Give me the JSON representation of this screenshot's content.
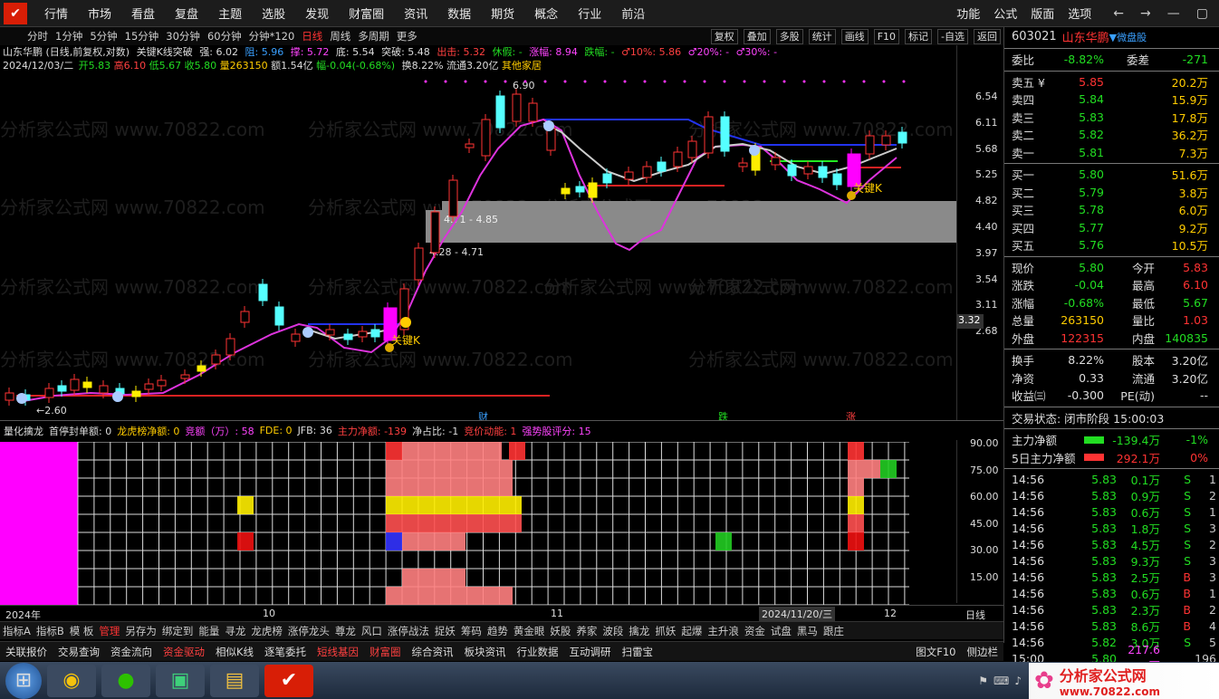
{
  "topmenu": [
    "行情",
    "市场",
    "看盘",
    "复盘",
    "主题",
    "选股",
    "发现",
    "财富圈",
    "资讯",
    "数据",
    "期货",
    "概念",
    "行业",
    "前沿"
  ],
  "topright": [
    "功能",
    "公式",
    "版面",
    "选项"
  ],
  "periods": [
    "分时",
    "1分钟",
    "5分钟",
    "15分钟",
    "30分钟",
    "60分钟",
    "分钟*120",
    "日线",
    "周线",
    "多周期",
    "更多"
  ],
  "tools": [
    "复权",
    "叠加",
    "多股",
    "统计",
    "画线",
    "F10",
    "标记",
    "-自选",
    "返回"
  ],
  "info": {
    "line1_a": "山东华鹏 (日线,前复权,对数)",
    "line1_b": "关键K线突破",
    "qiang": "强: 6.02",
    "zu": "阻: 5.96",
    "cheng": "撑: 5.72",
    "di": "底: 5.54",
    "tupo": "突破: 5.48",
    "shouyi": "出击: 5.32",
    "xiupan": "休假: -",
    "zhangfu": "涨幅: 8.94",
    "diefu": "跌幅: -",
    "p10": "♂10%: 5.86",
    "p20": "♂20%: -",
    "p30": "♂30%: -",
    "date": "2024/12/03/二",
    "open": "开5.83",
    "high": "高6.10",
    "low": "低5.67",
    "close": "收5.80",
    "vol": "量263150",
    "amt": "额1.54亿",
    "chg": "幅-0.04(-0.68%)",
    "turn": "换8.22%",
    "flow": "流通3.20亿",
    "other": "其他家居"
  },
  "annotations": {
    "high": "6.90",
    "low": "←2.60",
    "zone1": "4.71 - 4.85",
    "zone2": "4.28 - 4.71",
    "key1": "关键K",
    "key2": "关键K",
    "ev1": "财",
    "ev2": "跌",
    "ev3": "涨",
    "cur": "3.32"
  },
  "price_axis": [
    "6.54",
    "6.11",
    "5.68",
    "5.25",
    "4.82",
    "4.40",
    "3.97",
    "3.54",
    "3.11",
    "2.68"
  ],
  "ind": {
    "name": "量化擒龙",
    "a": "首停封单额: 0",
    "b": "龙虎榜净额: 0",
    "c": "竞额（万）: 58",
    "d": "FDE: 0",
    "e": "JFB: 36",
    "f": "主力净额: -139",
    "g": "净占比: -1",
    "h": "竞价动能: 1",
    "i": "强势股评分: 15"
  },
  "grid_axis": [
    "90.00",
    "75.00",
    "60.00",
    "45.00",
    "30.00",
    "15.00"
  ],
  "dates": {
    "y": "2024年",
    "m10": "10",
    "m11": "11",
    "d": "2024/11/20/三",
    "m12": "12",
    "p": "日线"
  },
  "tabs1": [
    "指标A",
    "指标B",
    "模 板",
    "管理",
    "另存为",
    "绑定到",
    "能量",
    "寻龙",
    "龙虎榜",
    "涨停龙头",
    "尊龙",
    "风口",
    "涨停战法",
    "捉妖",
    "筹码",
    "趋势",
    "黄金眼",
    "妖股",
    "养家",
    "波段",
    "擒龙",
    "抓妖",
    "起爆",
    "主升浪",
    "资金",
    "试盘",
    "黑马",
    "跟庄"
  ],
  "tabs2": [
    "关联报价",
    "交易查询",
    "资金流向",
    "资金驱动",
    "相似K线",
    "逐笔委托",
    "短线基因",
    "财富圈",
    "综合资讯",
    "板块资讯",
    "行业数据",
    "互动调研",
    "扫雷宝"
  ],
  "tabs2_right": [
    "图文F10",
    "侧边栏"
  ],
  "stock": {
    "code": "603021",
    "name": "山东华鹏",
    "tag": "▼微盘股"
  },
  "webi": {
    "l": "委比",
    "v": "-8.82%",
    "l2": "委差",
    "v2": "-271"
  },
  "asks": [
    {
      "l": "卖五 ¥",
      "p": "5.85",
      "v": "20.2万"
    },
    {
      "l": "卖四",
      "p": "5.84",
      "v": "15.9万"
    },
    {
      "l": "卖三",
      "p": "5.83",
      "v": "17.8万"
    },
    {
      "l": "卖二",
      "p": "5.82",
      "v": "36.2万"
    },
    {
      "l": "卖一",
      "p": "5.81",
      "v": "7.3万"
    }
  ],
  "bids": [
    {
      "l": "买一",
      "p": "5.80",
      "v": "51.6万"
    },
    {
      "l": "买二",
      "p": "5.79",
      "v": "3.8万"
    },
    {
      "l": "买三",
      "p": "5.78",
      "v": "6.0万"
    },
    {
      "l": "买四",
      "p": "5.77",
      "v": "9.2万"
    },
    {
      "l": "买五",
      "p": "5.76",
      "v": "10.5万"
    }
  ],
  "stats": [
    {
      "a": "现价",
      "b": "5.80",
      "c": "今开",
      "d": "5.83"
    },
    {
      "a": "涨跌",
      "b": "-0.04",
      "c": "最高",
      "d": "6.10"
    },
    {
      "a": "涨幅",
      "b": "-0.68%",
      "c": "最低",
      "d": "5.67"
    },
    {
      "a": "总量",
      "b": "263150",
      "c": "量比",
      "d": "1.03"
    },
    {
      "a": "外盘",
      "b": "122315",
      "c": "内盘",
      "d": "140835"
    }
  ],
  "stats2": [
    {
      "a": "换手",
      "b": "8.22%",
      "c": "股本",
      "d": "3.20亿"
    },
    {
      "a": "净资",
      "b": "0.33",
      "c": "流通",
      "d": "3.20亿"
    },
    {
      "a": "收益㈢",
      "b": "-0.300",
      "c": "PE(动)",
      "d": "--"
    }
  ],
  "trade_status": "交易状态: 闭市阶段 15:00:03",
  "flow": [
    {
      "l": "主力净额",
      "v": "-139.4万",
      "p": "-1%"
    },
    {
      "l": "5日主力净额",
      "v": "292.1万",
      "p": "0%"
    }
  ],
  "ticks": [
    [
      "14:56",
      "5.83",
      "0.1万",
      "S",
      "1"
    ],
    [
      "14:56",
      "5.83",
      "0.9万",
      "S",
      "2"
    ],
    [
      "14:56",
      "5.83",
      "0.6万",
      "S",
      "1"
    ],
    [
      "14:56",
      "5.83",
      "1.8万",
      "S",
      "3"
    ],
    [
      "14:56",
      "5.83",
      "4.5万",
      "S",
      "2"
    ],
    [
      "14:56",
      "5.83",
      "9.3万",
      "S",
      "3"
    ],
    [
      "14:56",
      "5.83",
      "2.5万",
      "B",
      "3"
    ],
    [
      "14:56",
      "5.83",
      "0.6万",
      "B",
      "1"
    ],
    [
      "14:56",
      "5.83",
      "2.3万",
      "B",
      "2"
    ],
    [
      "14:56",
      "5.83",
      "8.6万",
      "B",
      "4"
    ],
    [
      "14:56",
      "5.82",
      "3.0万",
      "S",
      "5"
    ],
    [
      "15:00",
      "5.80",
      "217.6万",
      "",
      "196"
    ]
  ],
  "watermark": "分析家公式网 www.70822.com",
  "brand": {
    "a": "分析家公式网",
    "b": "www.70822.com"
  }
}
